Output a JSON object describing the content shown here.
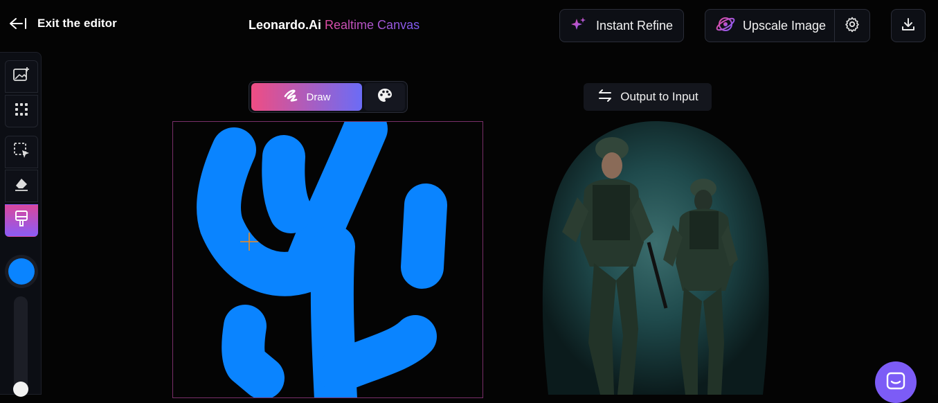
{
  "header": {
    "exit_label": "Exit the editor",
    "app_name": "Leonardo.Ai",
    "app_subtitle": "Realtime Canvas",
    "instant_refine_label": "Instant Refine",
    "upscale_label": "Upscale Image"
  },
  "toolbar": {
    "tools": [
      "add-image-icon",
      "grid-icon",
      "select-icon",
      "eraser-icon",
      "brush-icon"
    ],
    "active_tool": "brush",
    "brush_color": "#0a84ff"
  },
  "mode_toggle": {
    "draw_label": "Draw",
    "selected": "Draw"
  },
  "output": {
    "output_to_input_label": "Output to Input"
  },
  "colors": {
    "accent_pink": "#e14da5",
    "accent_purple": "#7c5cf6",
    "brush_blue": "#0a84ff",
    "chat_bubble": "#7c5cf6"
  }
}
